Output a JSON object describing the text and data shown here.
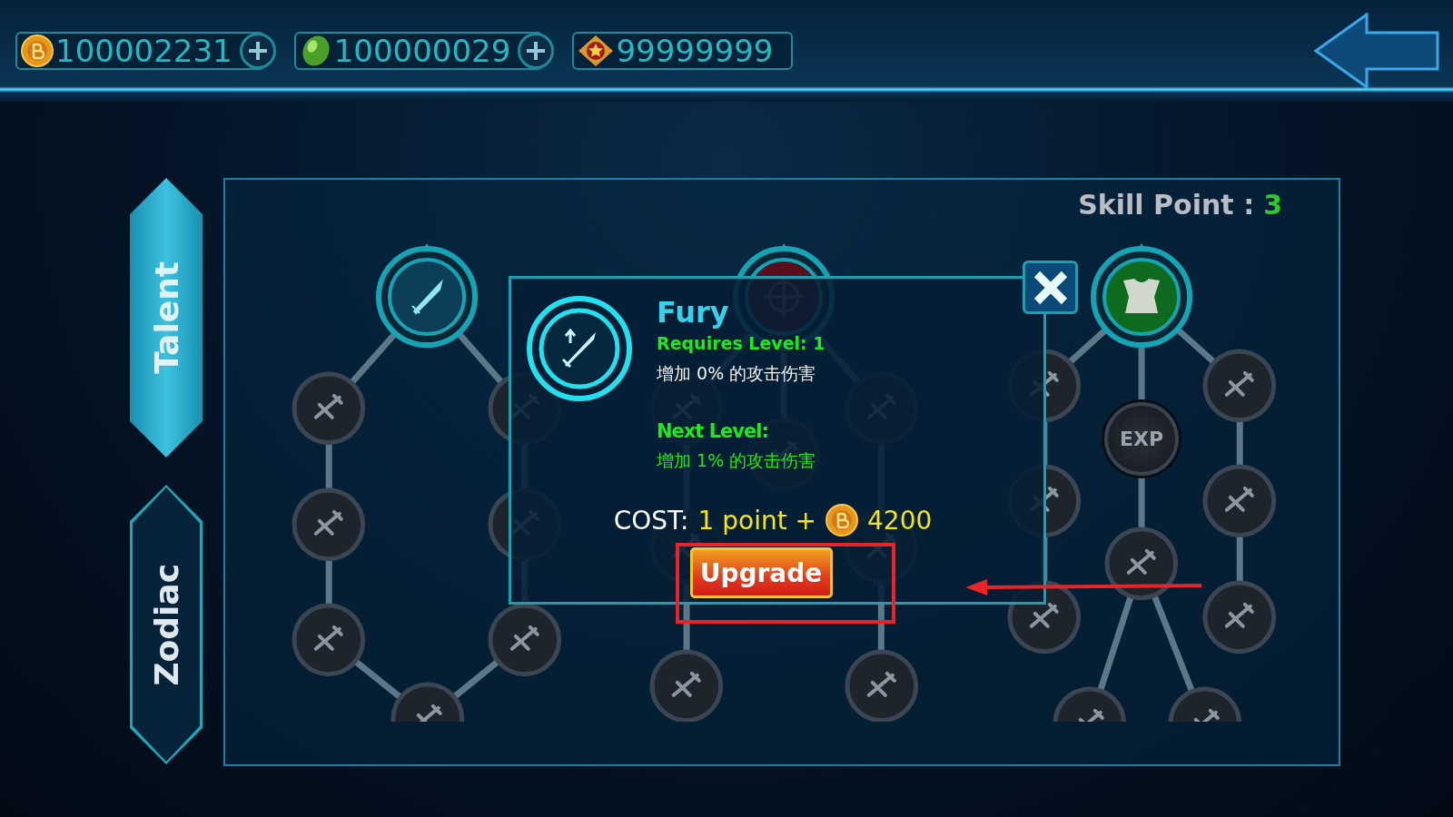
{
  "currencies": [
    {
      "kind": "coin",
      "amount": "100002231",
      "addable": true
    },
    {
      "kind": "gem",
      "amount": "100000029",
      "addable": true
    },
    {
      "kind": "star",
      "amount": "99999999",
      "addable": false
    }
  ],
  "side_tabs": [
    {
      "label": "Talent",
      "selected": true
    },
    {
      "label": "Zodiac",
      "selected": false
    }
  ],
  "skill_points": {
    "label": "Skill Point :",
    "value": "3"
  },
  "skill_tree": {
    "exp_label": "EXP"
  },
  "popup": {
    "name": "Fury",
    "requirement": "Requires Level: 1",
    "current_effect": "增加 0% 的攻击伤害",
    "next_label": "Next Level:",
    "next_effect": "增加 1% 的攻击伤害",
    "cost_label": "COST:",
    "cost_points": "1 point +",
    "cost_coins": "4200",
    "upgrade_button": "Upgrade"
  }
}
